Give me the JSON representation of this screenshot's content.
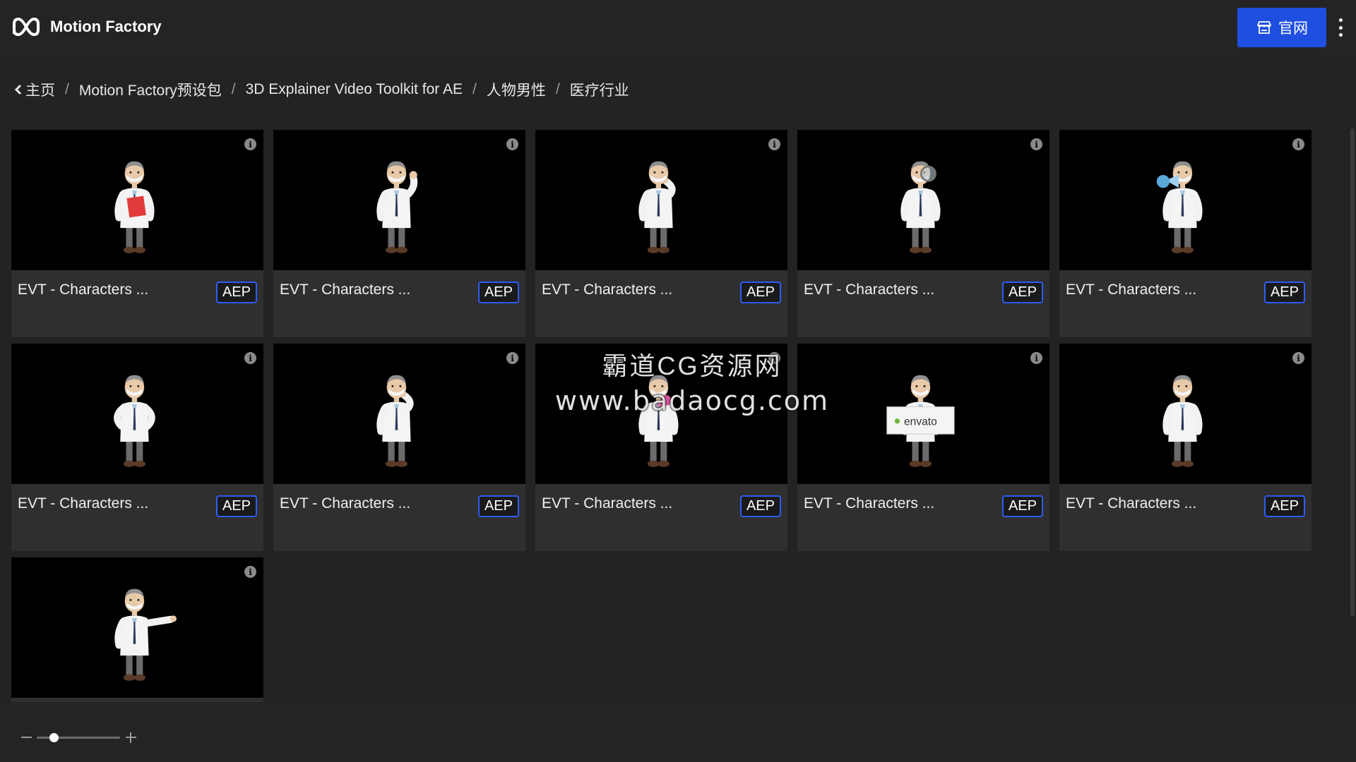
{
  "header": {
    "app_title": "Motion Factory",
    "logo_icon": "motion-factory-logo-icon",
    "site_button_label": "官网",
    "site_button_icon": "store-icon",
    "more_icon": "more-vertical-icon",
    "accent_color": "#1f4fe0"
  },
  "breadcrumb": {
    "back_icon": "chevron-left-icon",
    "items": [
      {
        "label": "主页"
      },
      {
        "label": "Motion Factory预设包"
      },
      {
        "label": "3D Explainer Video Toolkit for AE"
      },
      {
        "label": "人物男性"
      },
      {
        "label": "医疗行业"
      }
    ],
    "separator": "/"
  },
  "cards": [
    {
      "title": "EVT - Characters ...",
      "badge": "AEP",
      "pose": "clipboard"
    },
    {
      "title": "EVT - Characters ...",
      "badge": "AEP",
      "pose": "wave"
    },
    {
      "title": "EVT - Characters ...",
      "badge": "AEP",
      "pose": "thinking"
    },
    {
      "title": "EVT - Characters ...",
      "badge": "AEP",
      "pose": "magnifier"
    },
    {
      "title": "EVT - Characters ...",
      "badge": "AEP",
      "pose": "megaphone"
    },
    {
      "title": "EVT - Characters ...",
      "badge": "AEP",
      "pose": "hands-on-hips"
    },
    {
      "title": "EVT - Characters ...",
      "badge": "AEP",
      "pose": "phone"
    },
    {
      "title": "EVT - Characters ...",
      "badge": "AEP",
      "pose": "flower"
    },
    {
      "title": "EVT - Characters ...",
      "badge": "AEP",
      "pose": "sign",
      "sign_text": "envato"
    },
    {
      "title": "EVT - Characters ...",
      "badge": "AEP",
      "pose": "standing"
    },
    {
      "title": "",
      "badge": "",
      "pose": "pointing"
    }
  ],
  "watermark": {
    "line1": "霸道CG资源网",
    "line2": "www.badaocg.com"
  },
  "zoom": {
    "level_fraction": 0.2
  }
}
